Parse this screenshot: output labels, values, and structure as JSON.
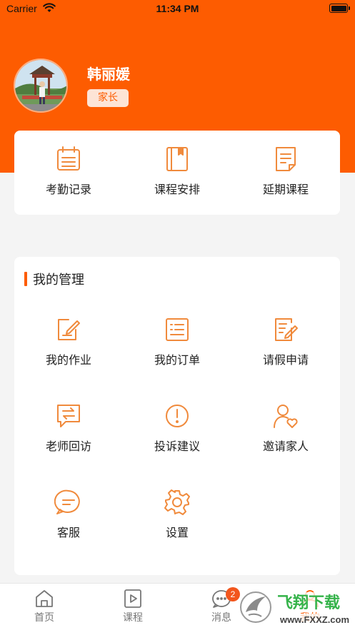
{
  "status_bar": {
    "carrier": "Carrier",
    "time": "11:34 PM"
  },
  "profile": {
    "name": "韩丽媛",
    "role": "家长"
  },
  "quick_actions": [
    {
      "label": "考勤记录",
      "icon": "calendar-icon"
    },
    {
      "label": "课程安排",
      "icon": "book-icon"
    },
    {
      "label": "延期课程",
      "icon": "document-icon"
    }
  ],
  "management": {
    "title": "我的管理",
    "items": [
      {
        "label": "我的作业",
        "icon": "edit-icon"
      },
      {
        "label": "我的订单",
        "icon": "order-icon"
      },
      {
        "label": "请假申请",
        "icon": "leave-form-icon"
      },
      {
        "label": "老师回访",
        "icon": "exchange-message-icon"
      },
      {
        "label": "投诉建议",
        "icon": "exclamation-icon"
      },
      {
        "label": "邀请家人",
        "icon": "invite-family-icon"
      },
      {
        "label": "客服",
        "icon": "chat-bubble-icon"
      },
      {
        "label": "设置",
        "icon": "gear-icon"
      }
    ]
  },
  "tab_bar": {
    "tabs": [
      {
        "label": "首页",
        "icon": "home-icon"
      },
      {
        "label": "课程",
        "icon": "video-course-icon"
      },
      {
        "label": "消息",
        "icon": "message-icon",
        "badge": "2"
      },
      {
        "label": "我的",
        "icon": "profile-icon"
      }
    ]
  },
  "watermark": {
    "text": "飞翔下载",
    "url": "www.FXXZ.com"
  },
  "colors": {
    "accent": "#fd5c01",
    "icon_stroke": "#f08a3c",
    "background": "#f4f4f4"
  }
}
